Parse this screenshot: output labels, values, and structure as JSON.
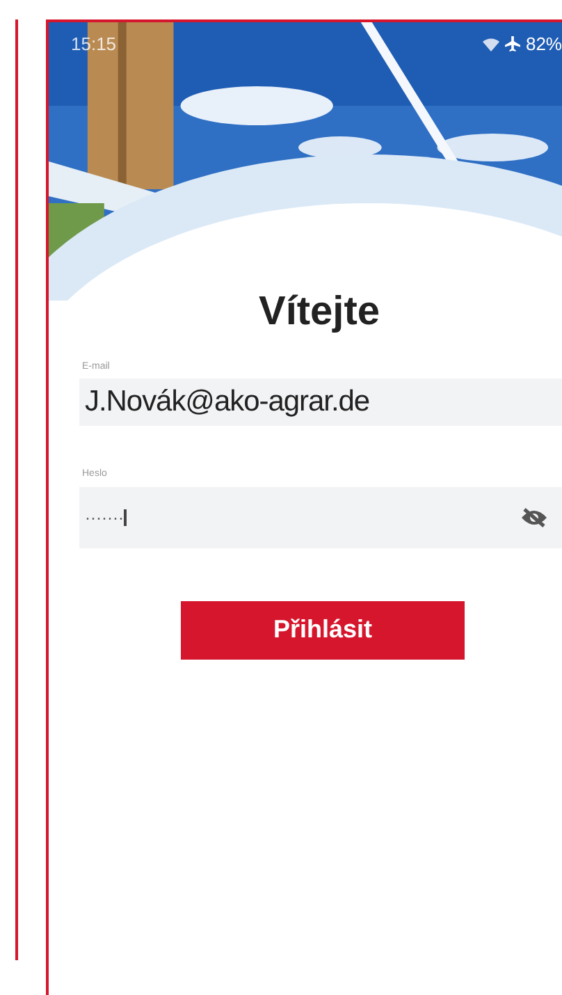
{
  "status_bar": {
    "time": "15:15",
    "battery": "82%",
    "wifi": true,
    "airplane_mode": true
  },
  "title": "Vítejte",
  "email": {
    "label": "E-mail",
    "value": "J.Novák@ako-agrar.de"
  },
  "password": {
    "label": "Heslo",
    "value": "·······",
    "visible": false,
    "focused": true
  },
  "login_button": "Přihlásit"
}
